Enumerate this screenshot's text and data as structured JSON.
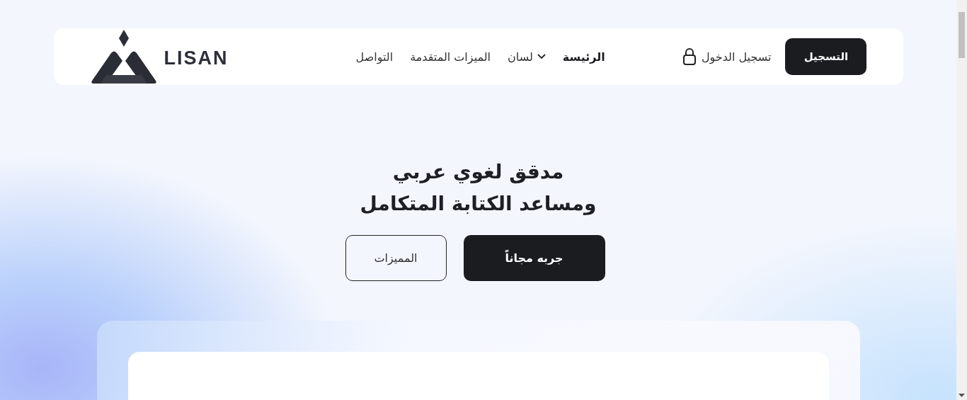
{
  "header": {
    "logo": {
      "text": "LISAN"
    },
    "nav": [
      {
        "label": "الرئيسة",
        "selected": true,
        "dropdown": false
      },
      {
        "label": "لسان",
        "selected": false,
        "dropdown": true
      },
      {
        "label": "الميزات المتقدمة",
        "selected": false,
        "dropdown": false
      },
      {
        "label": "التواصل",
        "selected": false,
        "dropdown": false
      }
    ],
    "login": "تسجيل الدخول",
    "register": "التسجيل"
  },
  "hero": {
    "title_lines": [
      "مدقق لغوي عربي",
      "ومساعد الكتابة المتكامل"
    ],
    "buttons": [
      {
        "label": "جربه مجاناً",
        "kind": "primary"
      },
      {
        "label": "المميزات",
        "kind": "outline"
      }
    ]
  }
}
